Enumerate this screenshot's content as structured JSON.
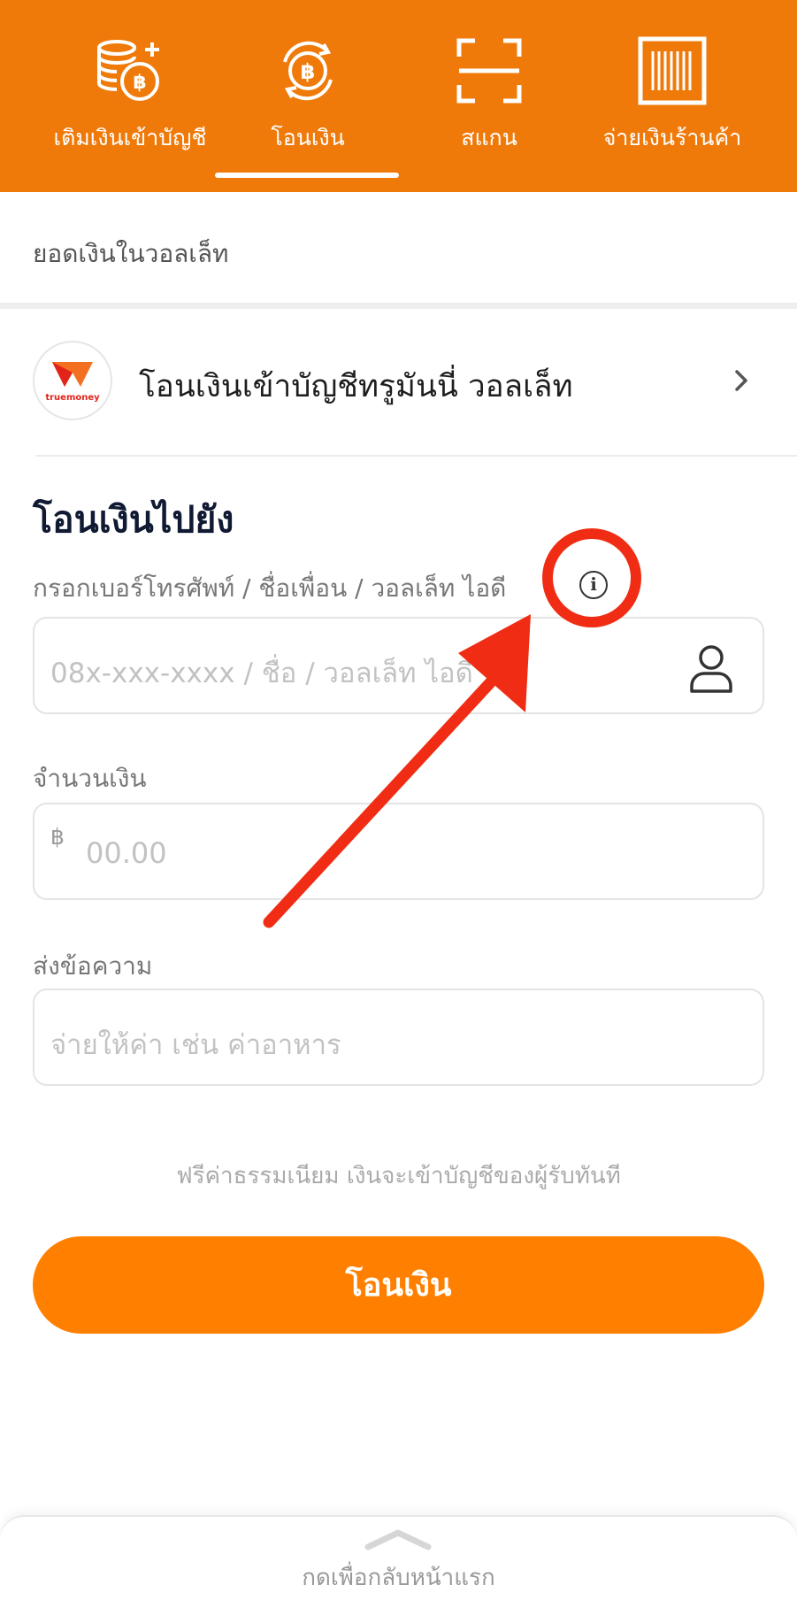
{
  "nav": {
    "items": [
      {
        "label": "เติมเงินเข้าบัญชี",
        "icon": "coin-stack-plus-icon"
      },
      {
        "label": "โอนเงิน",
        "icon": "baht-transfer-icon"
      },
      {
        "label": "สแกน",
        "icon": "scan-frame-icon"
      },
      {
        "label": "จ่ายเงินร้านค้า",
        "icon": "barcode-icon"
      }
    ],
    "active_index": 1
  },
  "balance": {
    "label": "ยอดเงินในวอลเล็ท"
  },
  "truemoney": {
    "logo_text": "truemoney",
    "label": "โอนเงินเข้าบัญชีทรูมันนี่ วอลเล็ท"
  },
  "transfer": {
    "title": "โอนเงินไปยัง",
    "recipient_label": "กรอกเบอร์โทรศัพท์ / ชื่อเพื่อน / วอลเล็ท ไอดี",
    "recipient_placeholder": "08x-xxx-xxxx / ชื่อ / วอลเล็ท ไอดี",
    "amount_label": "จำนวนเงิน",
    "currency_symbol": "฿",
    "amount_placeholder": "00.00",
    "message_label": "ส่งข้อความ",
    "message_placeholder": "จ่ายให้ค่า เช่น ค่าอาหาร",
    "fee_note": "ฟรีค่าธรรมเนียม เงินจะเข้าบัญชีของผู้รับทันที",
    "submit_label": "โอนเงิน"
  },
  "bottom_sheet": {
    "label": "กดเพื่อกลับหน้าแรก"
  },
  "colors": {
    "brand_orange": "#ef7a0a",
    "button_orange": "#ff8000",
    "annotation_red": "#f02d14",
    "title_navy": "#111a33"
  }
}
